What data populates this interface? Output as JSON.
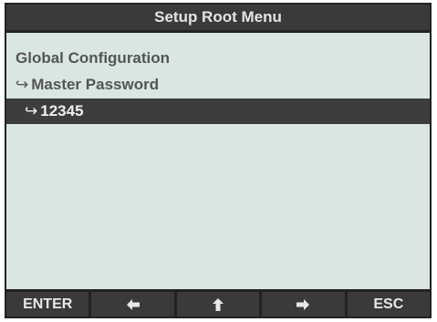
{
  "title": "Setup Root Menu",
  "menu": {
    "line1": "Global Configuration",
    "line2": {
      "arrow": "↪",
      "text": "Master Password"
    },
    "line3": {
      "arrow": "↪",
      "text": "12345"
    }
  },
  "softkeys": [
    {
      "label": "ENTER",
      "icon": null
    },
    {
      "label": "",
      "icon": "arrow-left-icon"
    },
    {
      "label": "",
      "icon": "arrow-up-icon"
    },
    {
      "label": "",
      "icon": "arrow-right-icon"
    },
    {
      "label": "ESC",
      "icon": null
    }
  ],
  "colors": {
    "bezel": "#222222",
    "title_bg": "#3a3a3a",
    "content_bg": "#d9e6e2",
    "highlight_bg": "#3d3d3d",
    "text": "#555555",
    "highlight_text": "#f0f0f0"
  }
}
